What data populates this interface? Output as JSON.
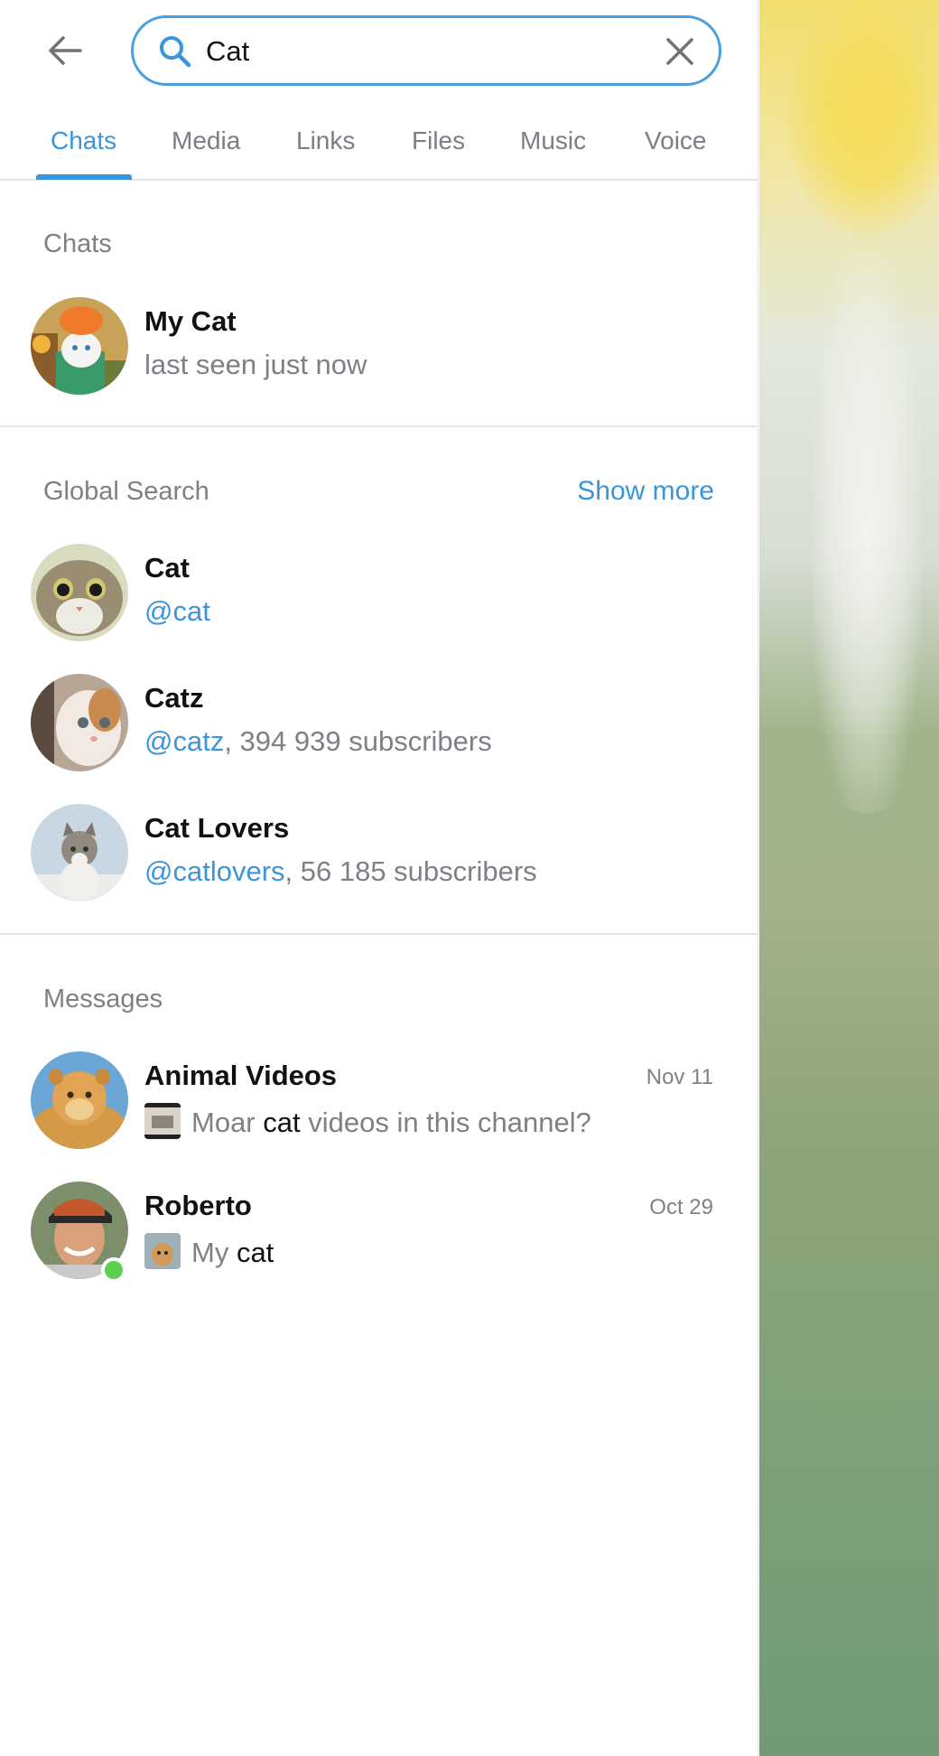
{
  "search": {
    "query": "Cat"
  },
  "tabs": [
    {
      "label": "Chats",
      "active": true
    },
    {
      "label": "Media"
    },
    {
      "label": "Links"
    },
    {
      "label": "Files"
    },
    {
      "label": "Music"
    },
    {
      "label": "Voice"
    }
  ],
  "chats_section": {
    "title": "Chats",
    "items": [
      {
        "name": "My Cat",
        "status": "last seen just now"
      }
    ]
  },
  "global_section": {
    "title": "Global Search",
    "show_more": "Show more",
    "items": [
      {
        "name": "Cat",
        "username": "@cat",
        "extra": ""
      },
      {
        "name": "Catz",
        "username": "@catz",
        "extra": ", 394 939 subscribers"
      },
      {
        "name": "Cat Lovers",
        "username": "@catlovers",
        "extra": ", 56 185 subscribers"
      }
    ]
  },
  "messages_section": {
    "title": "Messages",
    "items": [
      {
        "name": "Animal Videos",
        "date": "Nov 11",
        "before": "Moar ",
        "match": "cat",
        "after": " videos in this channel?"
      },
      {
        "name": "Roberto",
        "date": "Oct 29",
        "before": "My ",
        "match": "cat",
        "after": "",
        "online": true
      }
    ]
  },
  "colors": {
    "accent": "#3c95d9",
    "online": "#5bcf4e",
    "muted": "#7d8185"
  }
}
